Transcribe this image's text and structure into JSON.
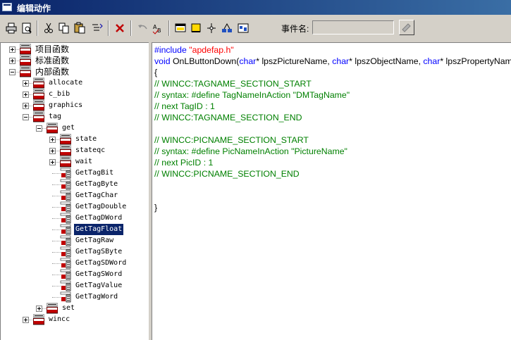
{
  "window": {
    "title": "编辑动作"
  },
  "toolbar": {
    "buttons": [
      {
        "name": "print-icon"
      },
      {
        "name": "print-preview-icon"
      },
      {
        "name": "cut-icon"
      },
      {
        "name": "copy-icon"
      },
      {
        "name": "paste-icon"
      },
      {
        "name": "format-icon"
      },
      {
        "name": "delete-icon"
      },
      {
        "name": "undo-icon"
      },
      {
        "name": "spell-icon"
      },
      {
        "name": "compile-icon"
      },
      {
        "name": "trigger-icon"
      },
      {
        "name": "tag-icon"
      },
      {
        "name": "object-icon"
      },
      {
        "name": "picture-icon"
      }
    ],
    "event_label": "事件名:",
    "event_value": ""
  },
  "tree": {
    "nodes": [
      {
        "label": "项目函数",
        "toggle": "+",
        "font": "cn"
      },
      {
        "label": "标准函数",
        "toggle": "+",
        "font": "cn"
      },
      {
        "label": "内部函数",
        "toggle": "-",
        "font": "cn"
      },
      {
        "label": "allocate",
        "toggle": "+",
        "font": "mono"
      },
      {
        "label": "c_bib",
        "toggle": "+",
        "font": "mono"
      },
      {
        "label": "graphics",
        "toggle": "+",
        "font": "mono"
      },
      {
        "label": "tag",
        "toggle": "-",
        "font": "mono"
      },
      {
        "label": "get",
        "toggle": "-",
        "font": "mono"
      },
      {
        "label": "state",
        "toggle": "+",
        "font": "mono"
      },
      {
        "label": "stateqc",
        "toggle": "+",
        "font": "mono"
      },
      {
        "label": "wait",
        "toggle": "+",
        "font": "mono"
      },
      {
        "label": "GetTagBit",
        "font": "mono"
      },
      {
        "label": "GetTagByte",
        "font": "mono"
      },
      {
        "label": "GetTagChar",
        "font": "mono"
      },
      {
        "label": "GetTagDouble",
        "font": "mono"
      },
      {
        "label": "GetTagDWord",
        "font": "mono"
      },
      {
        "label": "GetTagFloat",
        "font": "mono",
        "selected": true
      },
      {
        "label": "GetTagRaw",
        "font": "mono"
      },
      {
        "label": "GetTagSByte",
        "font": "mono"
      },
      {
        "label": "GetTagSDWord",
        "font": "mono"
      },
      {
        "label": "GetTagSWord",
        "font": "mono"
      },
      {
        "label": "GetTagValue",
        "font": "mono"
      },
      {
        "label": "GetTagWord",
        "font": "mono"
      },
      {
        "label": "set",
        "toggle": "+",
        "font": "mono"
      },
      {
        "label": "wincc",
        "toggle": "+",
        "font": "mono"
      }
    ]
  },
  "editor": {
    "lines": [
      [
        {
          "t": "#include ",
          "c": "kw"
        },
        {
          "t": "\"apdefap.h\"",
          "c": "str"
        }
      ],
      [
        {
          "t": "void ",
          "c": "kw"
        },
        {
          "t": "OnLButtonDown(",
          "c": ""
        },
        {
          "t": "char",
          "c": "kw"
        },
        {
          "t": "* lpszPictureName, ",
          "c": ""
        },
        {
          "t": "char",
          "c": "kw"
        },
        {
          "t": "* lpszObjectName, ",
          "c": ""
        },
        {
          "t": "char",
          "c": "kw"
        },
        {
          "t": "* lpszPropertyName, UINT nFlags, int x, int y)",
          "c": ""
        }
      ],
      [
        {
          "t": "{",
          "c": ""
        }
      ],
      [
        {
          "t": "// WINCC:TAGNAME_SECTION_START",
          "c": "cm"
        }
      ],
      [
        {
          "t": "// syntax: #define TagNameInAction \"DMTagName\"",
          "c": "cm"
        }
      ],
      [
        {
          "t": "// next TagID : 1",
          "c": "cm"
        }
      ],
      [
        {
          "t": "// WINCC:TAGNAME_SECTION_END",
          "c": "cm"
        }
      ],
      [],
      [
        {
          "t": "// WINCC:PICNAME_SECTION_START",
          "c": "cm"
        }
      ],
      [
        {
          "t": "// syntax: #define PicNameInAction \"PictureName\"",
          "c": "cm"
        }
      ],
      [
        {
          "t": "// next PicID : 1",
          "c": "cm"
        }
      ],
      [
        {
          "t": "// WINCC:PICNAME_SECTION_END",
          "c": "cm"
        }
      ],
      [],
      [],
      [
        {
          "t": "}",
          "c": ""
        }
      ]
    ]
  }
}
